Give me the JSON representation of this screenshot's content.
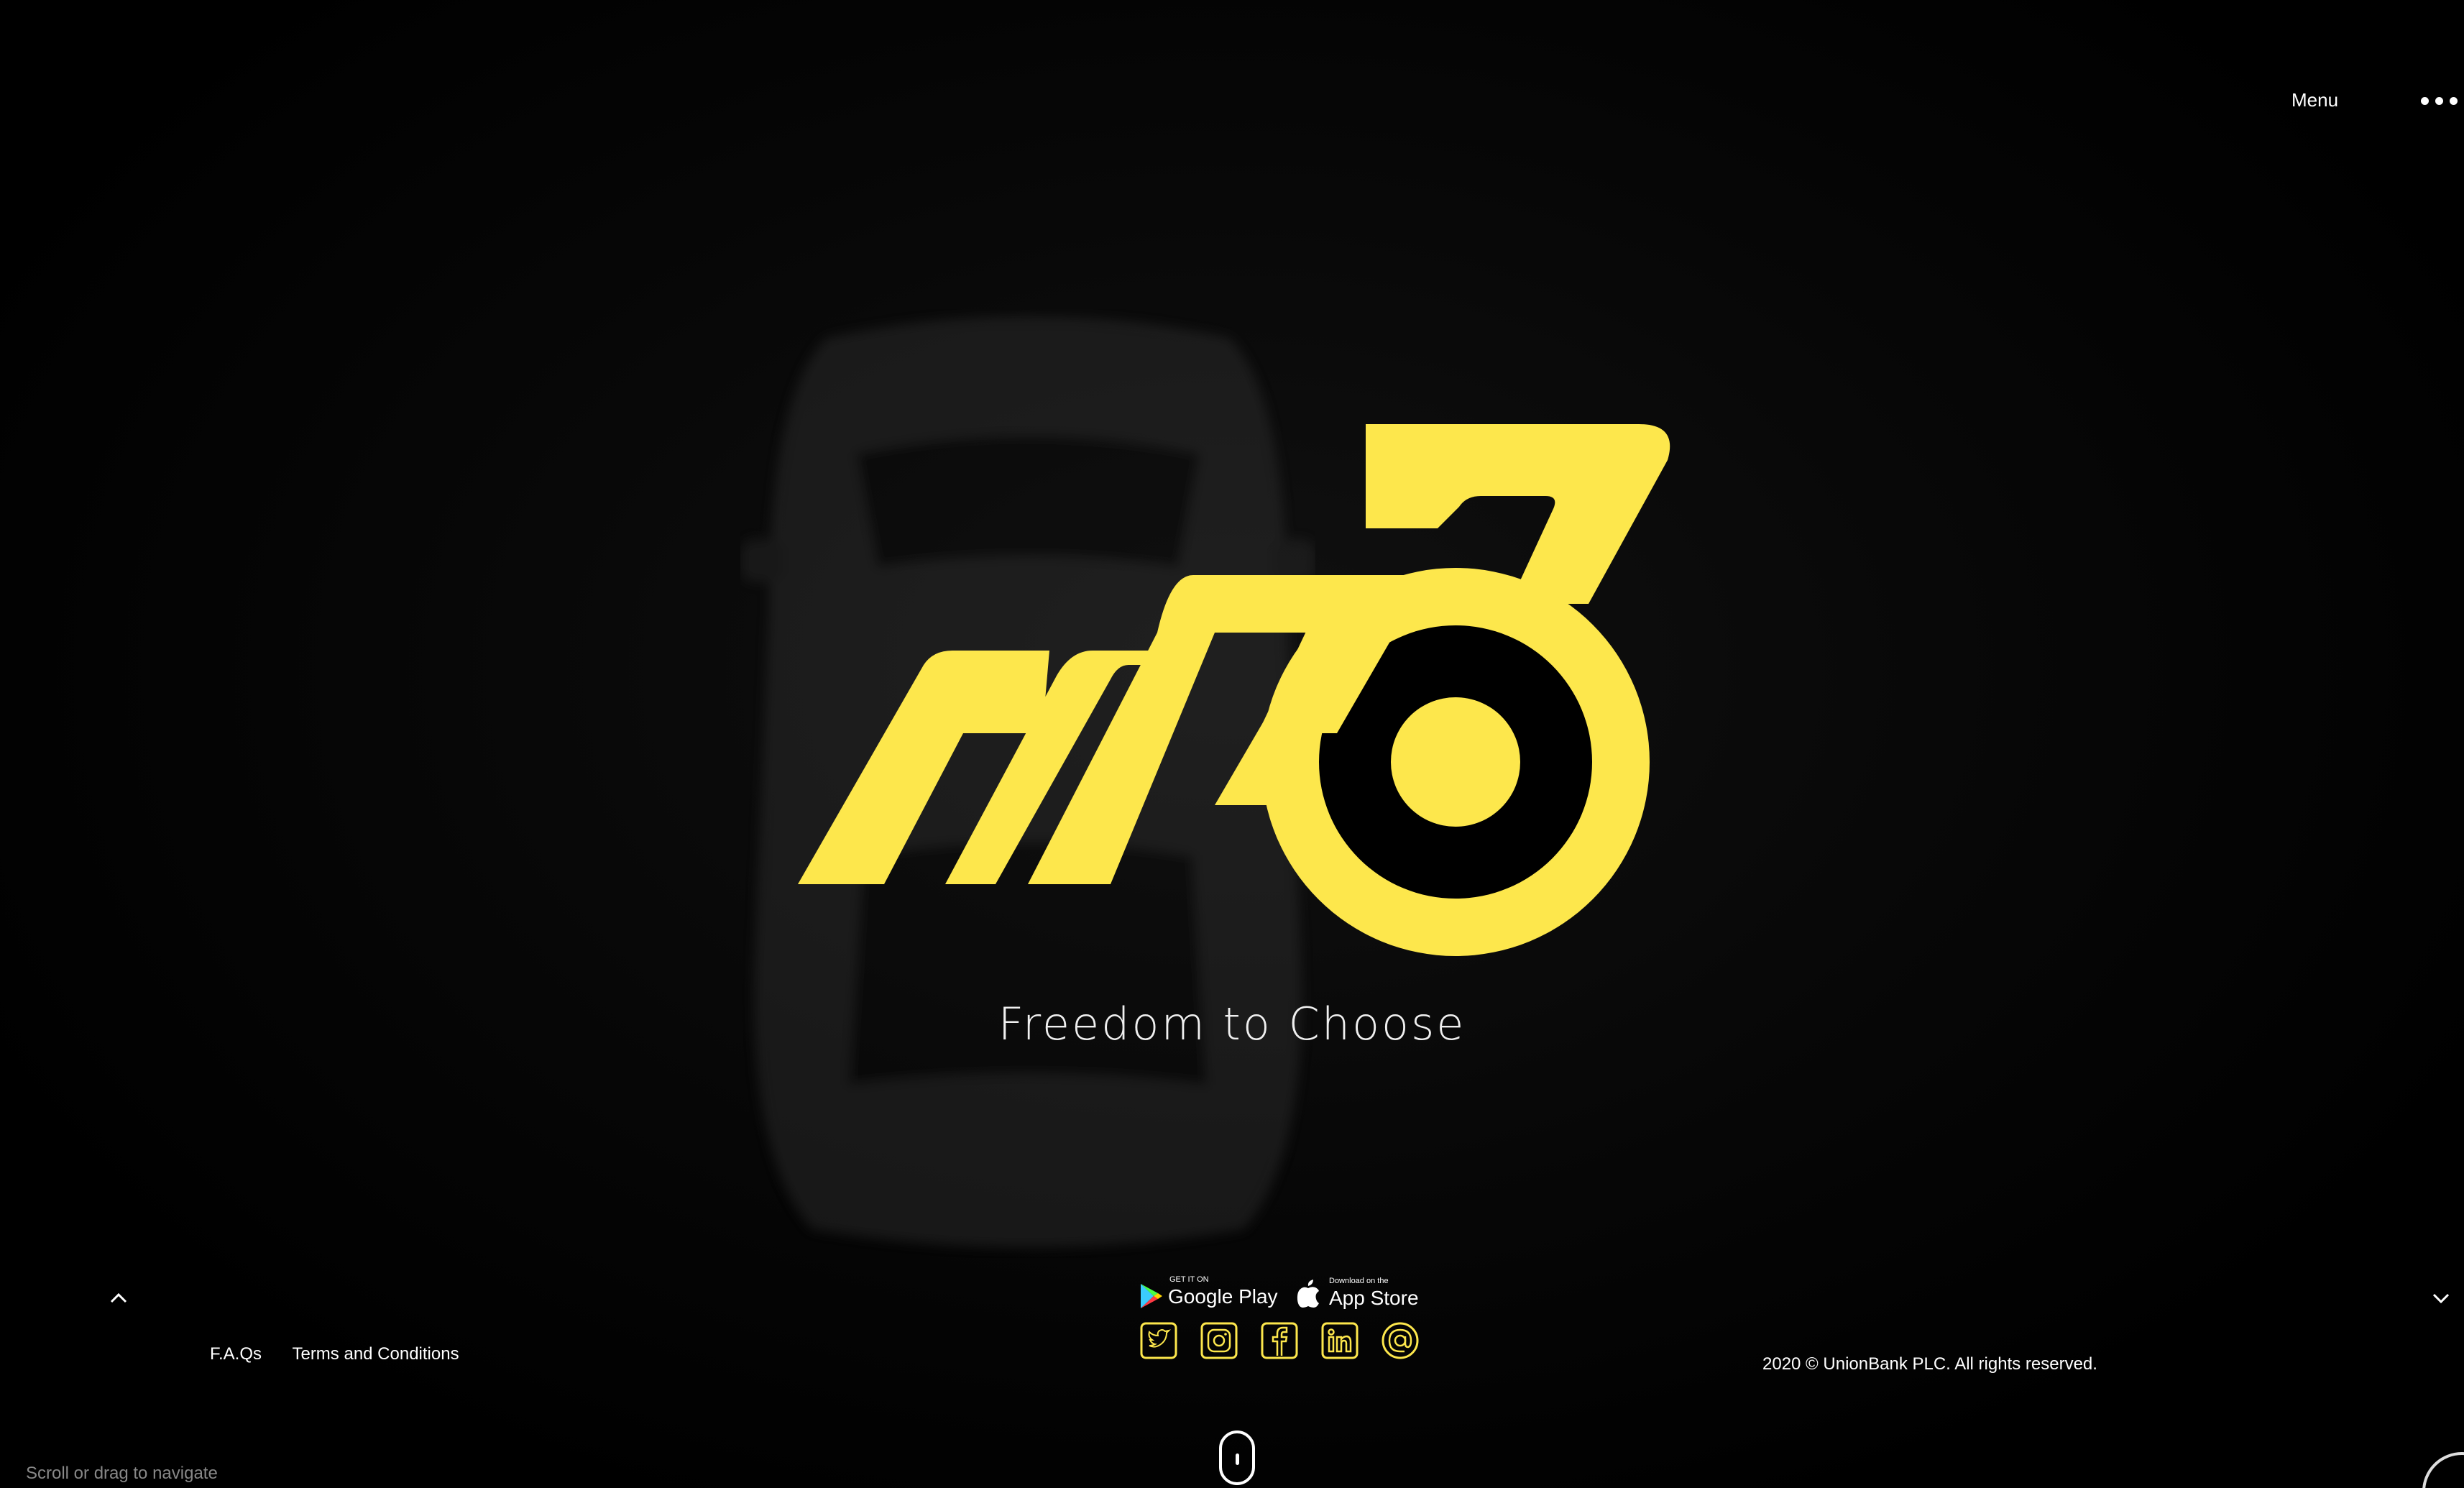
{
  "header": {
    "menu_label": "Menu",
    "menu_icon": "more-dots-icon"
  },
  "hero": {
    "logo_name": "m36 logo",
    "logo_color": "#FDE74C",
    "tagline": "Freedom to Choose"
  },
  "navigation": {
    "up_icon": "chevron-up-icon",
    "down_icon": "chevron-down-icon"
  },
  "stores": {
    "google": {
      "small": "GET IT ON",
      "big": "Google Play"
    },
    "apple": {
      "small": "Download on the",
      "big": "App Store"
    }
  },
  "socials": [
    {
      "name": "twitter-icon"
    },
    {
      "name": "instagram-icon"
    },
    {
      "name": "facebook-icon"
    },
    {
      "name": "linkedin-icon"
    },
    {
      "name": "email-icon"
    }
  ],
  "footer": {
    "links": [
      "F.A.Qs",
      "Terms and Conditions"
    ],
    "copyright": "2020 © UnionBank PLC. All rights reserved.",
    "scroll_hint": "Scroll or drag to navigate"
  },
  "colors": {
    "accent": "#FDE74C",
    "background": "#000000"
  }
}
